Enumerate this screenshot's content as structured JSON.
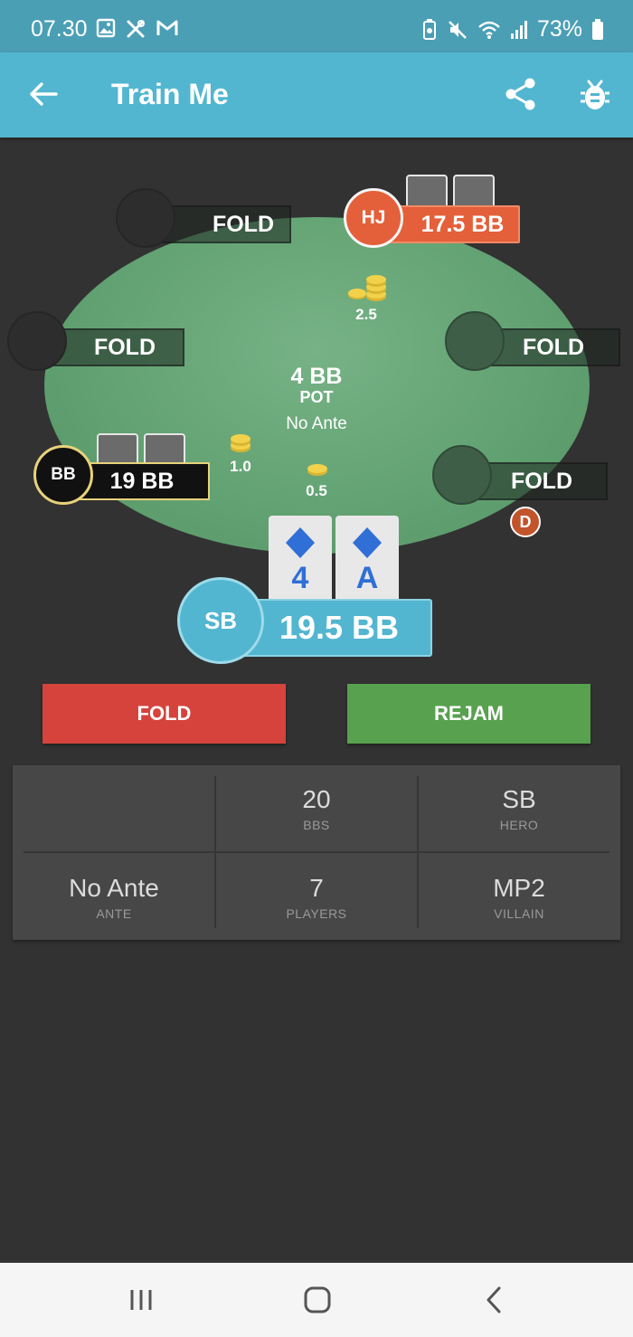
{
  "status_bar": {
    "time": "07.30",
    "battery": "73%"
  },
  "app_bar": {
    "title": "Train Me"
  },
  "table": {
    "pot_amount": "4 BB",
    "pot_label": "POT",
    "ante_text": "No Ante",
    "seats": {
      "top_left": {
        "label": "FOLD"
      },
      "left": {
        "label": "FOLD"
      },
      "right": {
        "label": "FOLD"
      },
      "bottom_right": {
        "label": "FOLD"
      },
      "hj": {
        "position": "HJ",
        "stack": "17.5 BB",
        "color": "#e4603a"
      },
      "bb": {
        "position": "BB",
        "stack": "19 BB"
      },
      "hero": {
        "position": "SB",
        "stack": "19.5 BB",
        "color": "#52b6d0"
      }
    },
    "bets": {
      "hj": "2.5",
      "bb": "1.0",
      "sb": "0.5"
    },
    "dealer_button": "D",
    "hero_cards": [
      {
        "rank": "4",
        "suit": "diamond"
      },
      {
        "rank": "A",
        "suit": "diamond"
      }
    ]
  },
  "actions": {
    "fold": "FOLD",
    "rejam": "REJAM"
  },
  "info": [
    {
      "value": "",
      "key": ""
    },
    {
      "value": "20",
      "key": "BBS"
    },
    {
      "value": "SB",
      "key": "HERO"
    },
    {
      "value": "No Ante",
      "key": "ANTE"
    },
    {
      "value": "7",
      "key": "PLAYERS"
    },
    {
      "value": "MP2",
      "key": "VILLAIN"
    }
  ]
}
